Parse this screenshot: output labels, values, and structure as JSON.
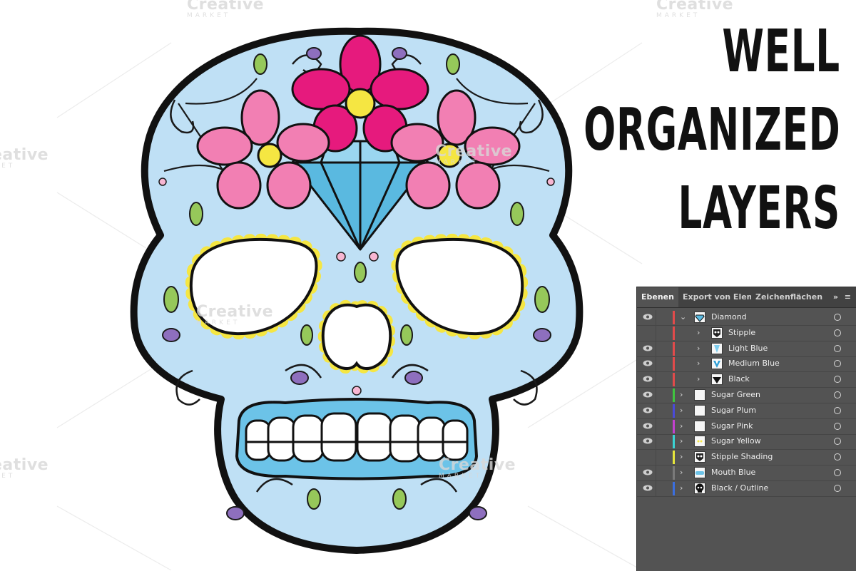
{
  "headline": [
    "WELL",
    "ORGANIZED",
    "LAYERS"
  ],
  "watermark": {
    "word": "Creative",
    "sub": "MARKET"
  },
  "colors": {
    "skull_fill": "#bfe0f5",
    "flower_pink": "#f27fb3",
    "flower_magenta": "#e61a7d",
    "diamond": "#5ab9e0",
    "yellow": "#f5e642",
    "green": "#96c85a",
    "plum": "#8e6fbe",
    "outline": "#111111",
    "panel_bg": "#535353"
  },
  "panel": {
    "tabs": [
      "Ebenen",
      "Export von Elem",
      "Zeichenflächen"
    ],
    "more_icon": "double-chevron-right-icon",
    "menu_icon": "hamburger-menu-icon",
    "layers": [
      {
        "name": "Diamond",
        "visible": true,
        "color": "#e24b4b",
        "level": 0,
        "expanded": true,
        "thumb": "diamond"
      },
      {
        "name": "Stipple",
        "visible": false,
        "color": "#e24b4b",
        "level": 1,
        "expanded": false,
        "thumb": "stipple"
      },
      {
        "name": "Light Blue",
        "visible": true,
        "color": "#e24b4b",
        "level": 1,
        "expanded": false,
        "thumb": "lightblue"
      },
      {
        "name": "Medium Blue",
        "visible": true,
        "color": "#e24b4b",
        "level": 1,
        "expanded": false,
        "thumb": "mediumblue"
      },
      {
        "name": "Black",
        "visible": true,
        "color": "#e24b4b",
        "level": 1,
        "expanded": false,
        "thumb": "black"
      },
      {
        "name": "Sugar Green",
        "visible": true,
        "color": "#3fc53f",
        "level": 0,
        "expanded": false,
        "thumb": "blank"
      },
      {
        "name": "Sugar Plum",
        "visible": true,
        "color": "#4a4ad9",
        "level": 0,
        "expanded": false,
        "thumb": "blank"
      },
      {
        "name": "Sugar Pink",
        "visible": true,
        "color": "#c341d0",
        "level": 0,
        "expanded": false,
        "thumb": "blank"
      },
      {
        "name": "Sugar Yellow",
        "visible": true,
        "color": "#3ad4d4",
        "level": 0,
        "expanded": false,
        "thumb": "yellow"
      },
      {
        "name": "Stipple Shading",
        "visible": false,
        "color": "#e6e63c",
        "level": 0,
        "expanded": false,
        "thumb": "stipple"
      },
      {
        "name": "Mouth Blue",
        "visible": true,
        "color": "#7a7a7a",
        "level": 0,
        "expanded": false,
        "thumb": "mouth"
      },
      {
        "name": "Black / Outline",
        "visible": true,
        "color": "#3b6fe0",
        "level": 0,
        "expanded": false,
        "thumb": "skull"
      }
    ]
  }
}
